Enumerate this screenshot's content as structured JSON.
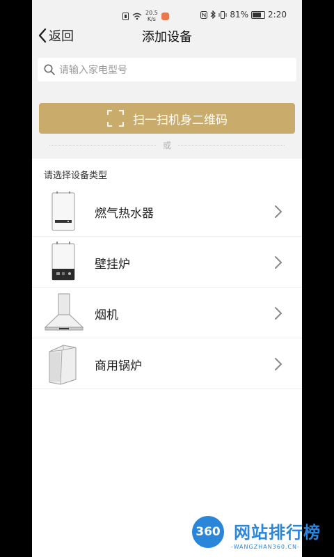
{
  "status_bar": {
    "net_speed_value": "20.5",
    "net_speed_unit": "K/s",
    "battery": "81%",
    "time": "2:20"
  },
  "nav": {
    "back_label": "返回",
    "title": "添加设备"
  },
  "search": {
    "placeholder": "请输入家电型号"
  },
  "scan": {
    "label": "扫一扫机身二维码"
  },
  "divider": {
    "or_label": "或"
  },
  "device_section": {
    "label": "请选择设备类型",
    "items": [
      {
        "label": "燃气热水器",
        "icon": "gas-water-heater-icon"
      },
      {
        "label": "壁挂炉",
        "icon": "wall-boiler-icon"
      },
      {
        "label": "烟机",
        "icon": "range-hood-icon"
      },
      {
        "label": "商用锅炉",
        "icon": "commercial-boiler-icon"
      }
    ]
  },
  "watermark": {
    "badge": "360",
    "title": "网站排行榜",
    "subtitle": "-WANGZHAN360.CN-"
  },
  "colors": {
    "accent": "#c9ab6c",
    "background": "#f2f2f2",
    "watermark_blue": "#2b86d9"
  }
}
